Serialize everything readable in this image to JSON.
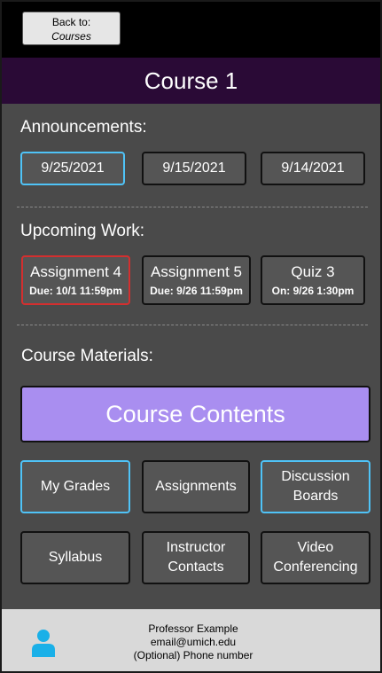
{
  "back": {
    "line1": "Back to:",
    "line2": "Courses"
  },
  "course_title": "Course 1",
  "announcements": {
    "heading": "Announcements:",
    "dates": [
      "9/25/2021",
      "9/15/2021",
      "9/14/2021"
    ]
  },
  "upcoming": {
    "heading": "Upcoming Work:",
    "items": [
      {
        "title": "Assignment 4",
        "due": "Due: 10/1 11:59pm"
      },
      {
        "title": "Assignment 5",
        "due": "Due: 9/26 11:59pm"
      },
      {
        "title": "Quiz 3",
        "due": "On: 9/26 1:30pm"
      }
    ]
  },
  "materials": {
    "heading": "Course Materials:",
    "contents_label": "Course Contents",
    "buttons": [
      "My Grades",
      "Assignments",
      "Discussion Boards",
      "Syllabus",
      "Instructor Contacts",
      "Video Conferencing"
    ]
  },
  "footer": {
    "name": "Professor Example",
    "email": "email@umich.edu",
    "phone": "(Optional) Phone number"
  },
  "colors": {
    "accent_blue": "#4fc3f7",
    "accent_red": "#d32f2f",
    "header_purple": "#2a0a36",
    "contents_purple": "#a98ef0",
    "avatar_blue": "#1ab0e8"
  },
  "icons": {
    "avatar": "person-icon"
  }
}
